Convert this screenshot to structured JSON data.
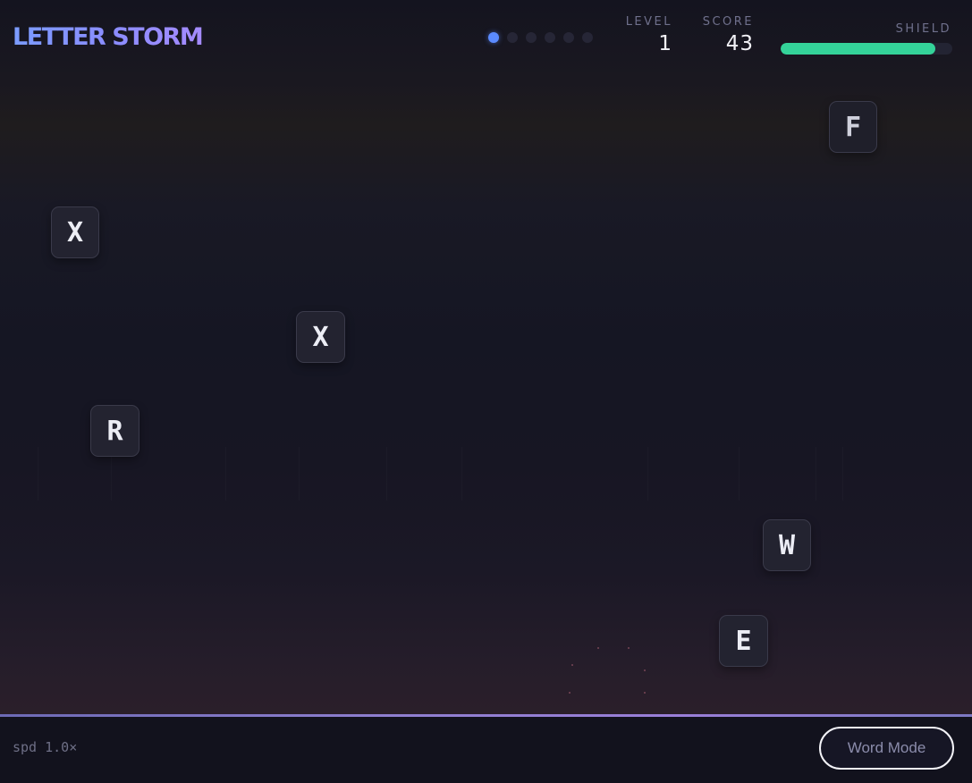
{
  "hud": {
    "title": "LETTER STORM",
    "progress_dots": {
      "total": 6,
      "active": 1
    },
    "level_label": "LEVEL",
    "level_value": "1",
    "score_label": "SCORE",
    "score_value": "43",
    "shield_label": "SHIELD",
    "shield_fraction": 0.9
  },
  "tiles": [
    {
      "letter": "F"
    },
    {
      "letter": "X"
    },
    {
      "letter": "X"
    },
    {
      "letter": "R"
    },
    {
      "letter": "W"
    },
    {
      "letter": "E"
    }
  ],
  "footer": {
    "speed": "spd 1.0×",
    "word_mode_label": "Word Mode"
  },
  "colors": {
    "accent": "#5b8bff",
    "shield": "#34d399",
    "title_gradient_start": "#7b9cff",
    "title_gradient_end": "#a58bff"
  }
}
